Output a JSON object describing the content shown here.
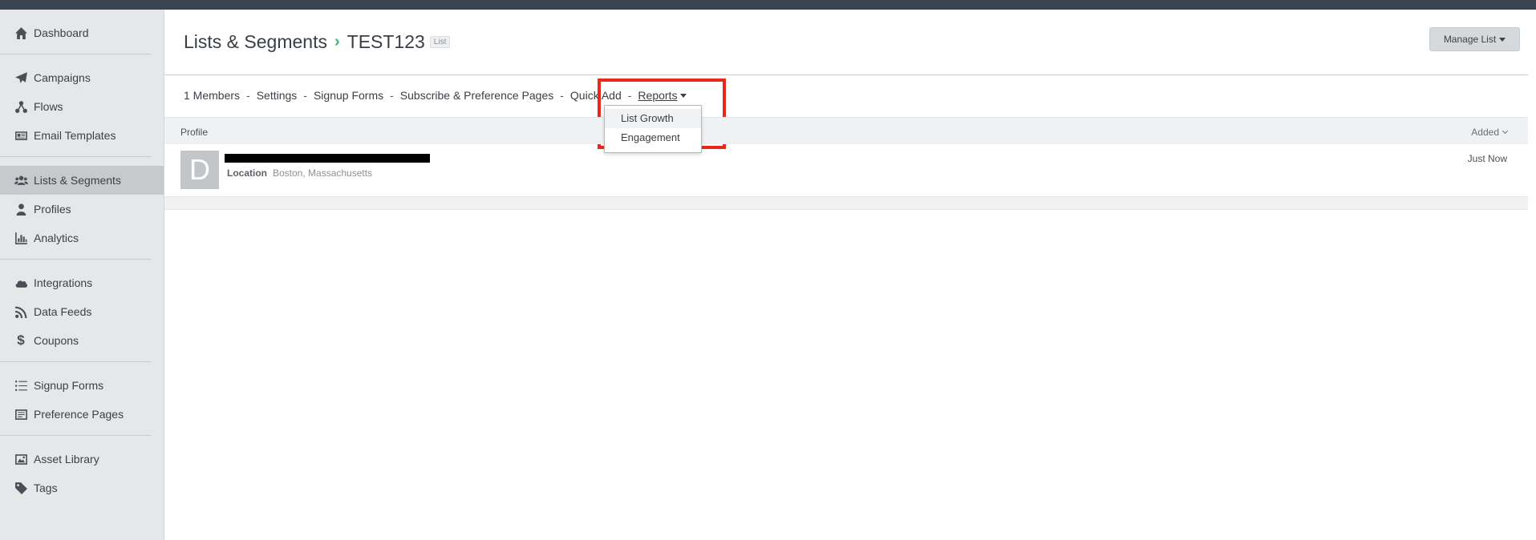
{
  "sidebar": {
    "groups": [
      [
        {
          "label": "Dashboard",
          "icon": "home-icon"
        }
      ],
      [
        {
          "label": "Campaigns",
          "icon": "paper-plane-icon"
        },
        {
          "label": "Flows",
          "icon": "flows-icon"
        },
        {
          "label": "Email Templates",
          "icon": "template-icon"
        }
      ],
      [
        {
          "label": "Lists & Segments",
          "icon": "users-icon",
          "active": true
        },
        {
          "label": "Profiles",
          "icon": "user-icon"
        },
        {
          "label": "Analytics",
          "icon": "bar-chart-icon"
        }
      ],
      [
        {
          "label": "Integrations",
          "icon": "cloud-icon"
        },
        {
          "label": "Data Feeds",
          "icon": "rss-icon"
        },
        {
          "label": "Coupons",
          "icon": "dollar-icon"
        }
      ],
      [
        {
          "label": "Signup Forms",
          "icon": "list-icon"
        },
        {
          "label": "Preference Pages",
          "icon": "form-icon"
        }
      ],
      [
        {
          "label": "Asset Library",
          "icon": "image-icon"
        },
        {
          "label": "Tags",
          "icon": "tag-icon"
        }
      ]
    ]
  },
  "header": {
    "breadcrumb_parent": "Lists & Segments",
    "breadcrumb_sep": "›",
    "title": "TEST123",
    "type_tag": "List",
    "manage_button": "Manage List"
  },
  "subnav": {
    "members": "1 Members",
    "settings": "Settings",
    "signup_forms": "Signup Forms",
    "subscribe_pages": "Subscribe & Preference Pages",
    "quick_add": "Quick Add",
    "reports": "Reports",
    "separator": "-"
  },
  "reports_menu": {
    "items": [
      "List Growth",
      "Engagement"
    ]
  },
  "table": {
    "col_profile": "Profile",
    "col_added": "Added",
    "rows": [
      {
        "avatar_letter": "D",
        "location_label": "Location",
        "location": "Boston, Massachusetts",
        "added": "Just Now"
      }
    ]
  },
  "colors": {
    "accent_green": "#2fbc6f",
    "highlight_red": "#e8281c",
    "sidebar_bg": "#e5e7e9"
  }
}
